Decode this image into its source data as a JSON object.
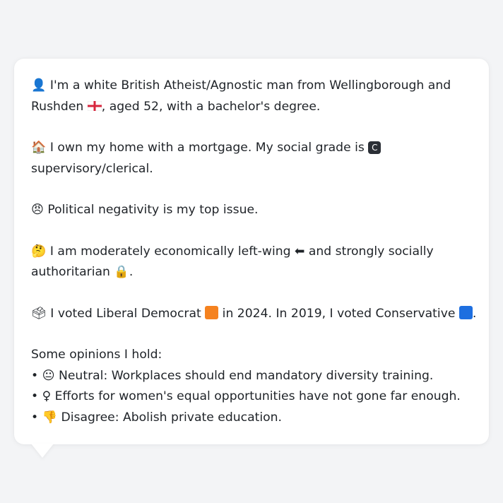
{
  "profile": {
    "identity": {
      "icon": "person-silhouette-icon",
      "emoji": "👤",
      "text_1": "I'm a white British Atheist/Agnostic man from Wellingborough and",
      "text_2a": "Rushden ",
      "flag_icon": "england-flag-icon",
      "text_2b": ", aged 52, with a bachelor's degree."
    },
    "home": {
      "emoji": "🏠",
      "text_1": "I own my home with a mortgage. My social grade is ",
      "grade_badge": "C",
      "text_2": "supervisory/clerical."
    },
    "issue": {
      "emoji": "😠",
      "text": "Political negativity is my top issue."
    },
    "ideology": {
      "emoji": "🤔",
      "text_1a": "I am moderately economically left-wing ",
      "left_arrow_emoji": "⬅",
      "text_1b": " and strongly socially",
      "text_2": "authoritarian ",
      "lock_emoji": "🔒",
      "text_2b": "."
    },
    "vote": {
      "emoji": "🗳",
      "text_a": "I voted Liberal Democrat ",
      "libdem_color": "#f5821f",
      "text_b": " in 2024. In 2019, I voted Conservative ",
      "con_color": "#1e6fe0",
      "text_c": "."
    },
    "opinions": {
      "heading": "Some opinions I hold:",
      "items": [
        {
          "bullet": "•",
          "emoji": "😐",
          "text": "Neutral: Workplaces should end mandatory diversity training."
        },
        {
          "bullet": "•",
          "emoji": "♀",
          "text": "Efforts for women's equal opportunities have not gone far enough."
        },
        {
          "bullet": "•",
          "emoji": "👎",
          "text": "Disagree: Abolish private education."
        }
      ]
    }
  }
}
